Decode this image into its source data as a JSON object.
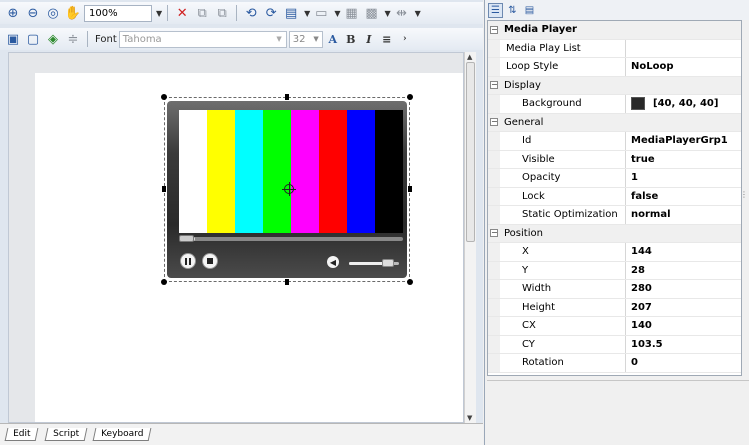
{
  "toolbar": {
    "zoom_value": "100%",
    "font_label": "Font",
    "font_name": "Tahoma",
    "font_size": "32",
    "bold_label": "B",
    "italic_label": "I"
  },
  "colors": {
    "test_bars": [
      "#ffffff",
      "#ffff00",
      "#00ffff",
      "#00ff00",
      "#ff00ff",
      "#ff0000",
      "#0000ff",
      "#000000"
    ]
  },
  "player": {
    "seek_fraction": 0.07,
    "volume_fraction": 0.85
  },
  "tabs": [
    {
      "label": "Edit"
    },
    {
      "label": "Script"
    },
    {
      "label": "Keyboard"
    }
  ],
  "properties": {
    "category_main": "Media Player",
    "media_play_list": {
      "label": "Media Play List",
      "value": ""
    },
    "loop_style": {
      "label": "Loop Style",
      "value": "NoLoop"
    },
    "display": {
      "label": "Display",
      "background": {
        "label": "Background",
        "value": "[40, 40, 40]",
        "color": "#282828"
      }
    },
    "general": {
      "label": "General",
      "id": {
        "label": "Id",
        "value": "MediaPlayerGrp1"
      },
      "visible": {
        "label": "Visible",
        "value": "true"
      },
      "opacity": {
        "label": "Opacity",
        "value": "1"
      },
      "lock": {
        "label": "Lock",
        "value": "false"
      },
      "static_opt": {
        "label": "Static Optimization",
        "value": "normal"
      }
    },
    "position": {
      "label": "Position",
      "x": {
        "label": "X",
        "value": "144"
      },
      "y": {
        "label": "Y",
        "value": "28"
      },
      "width": {
        "label": "Width",
        "value": "280"
      },
      "height": {
        "label": "Height",
        "value": "207"
      },
      "cx": {
        "label": "CX",
        "value": "140"
      },
      "cy": {
        "label": "CY",
        "value": "103.5"
      },
      "rotation": {
        "label": "Rotation",
        "value": "0"
      }
    }
  }
}
